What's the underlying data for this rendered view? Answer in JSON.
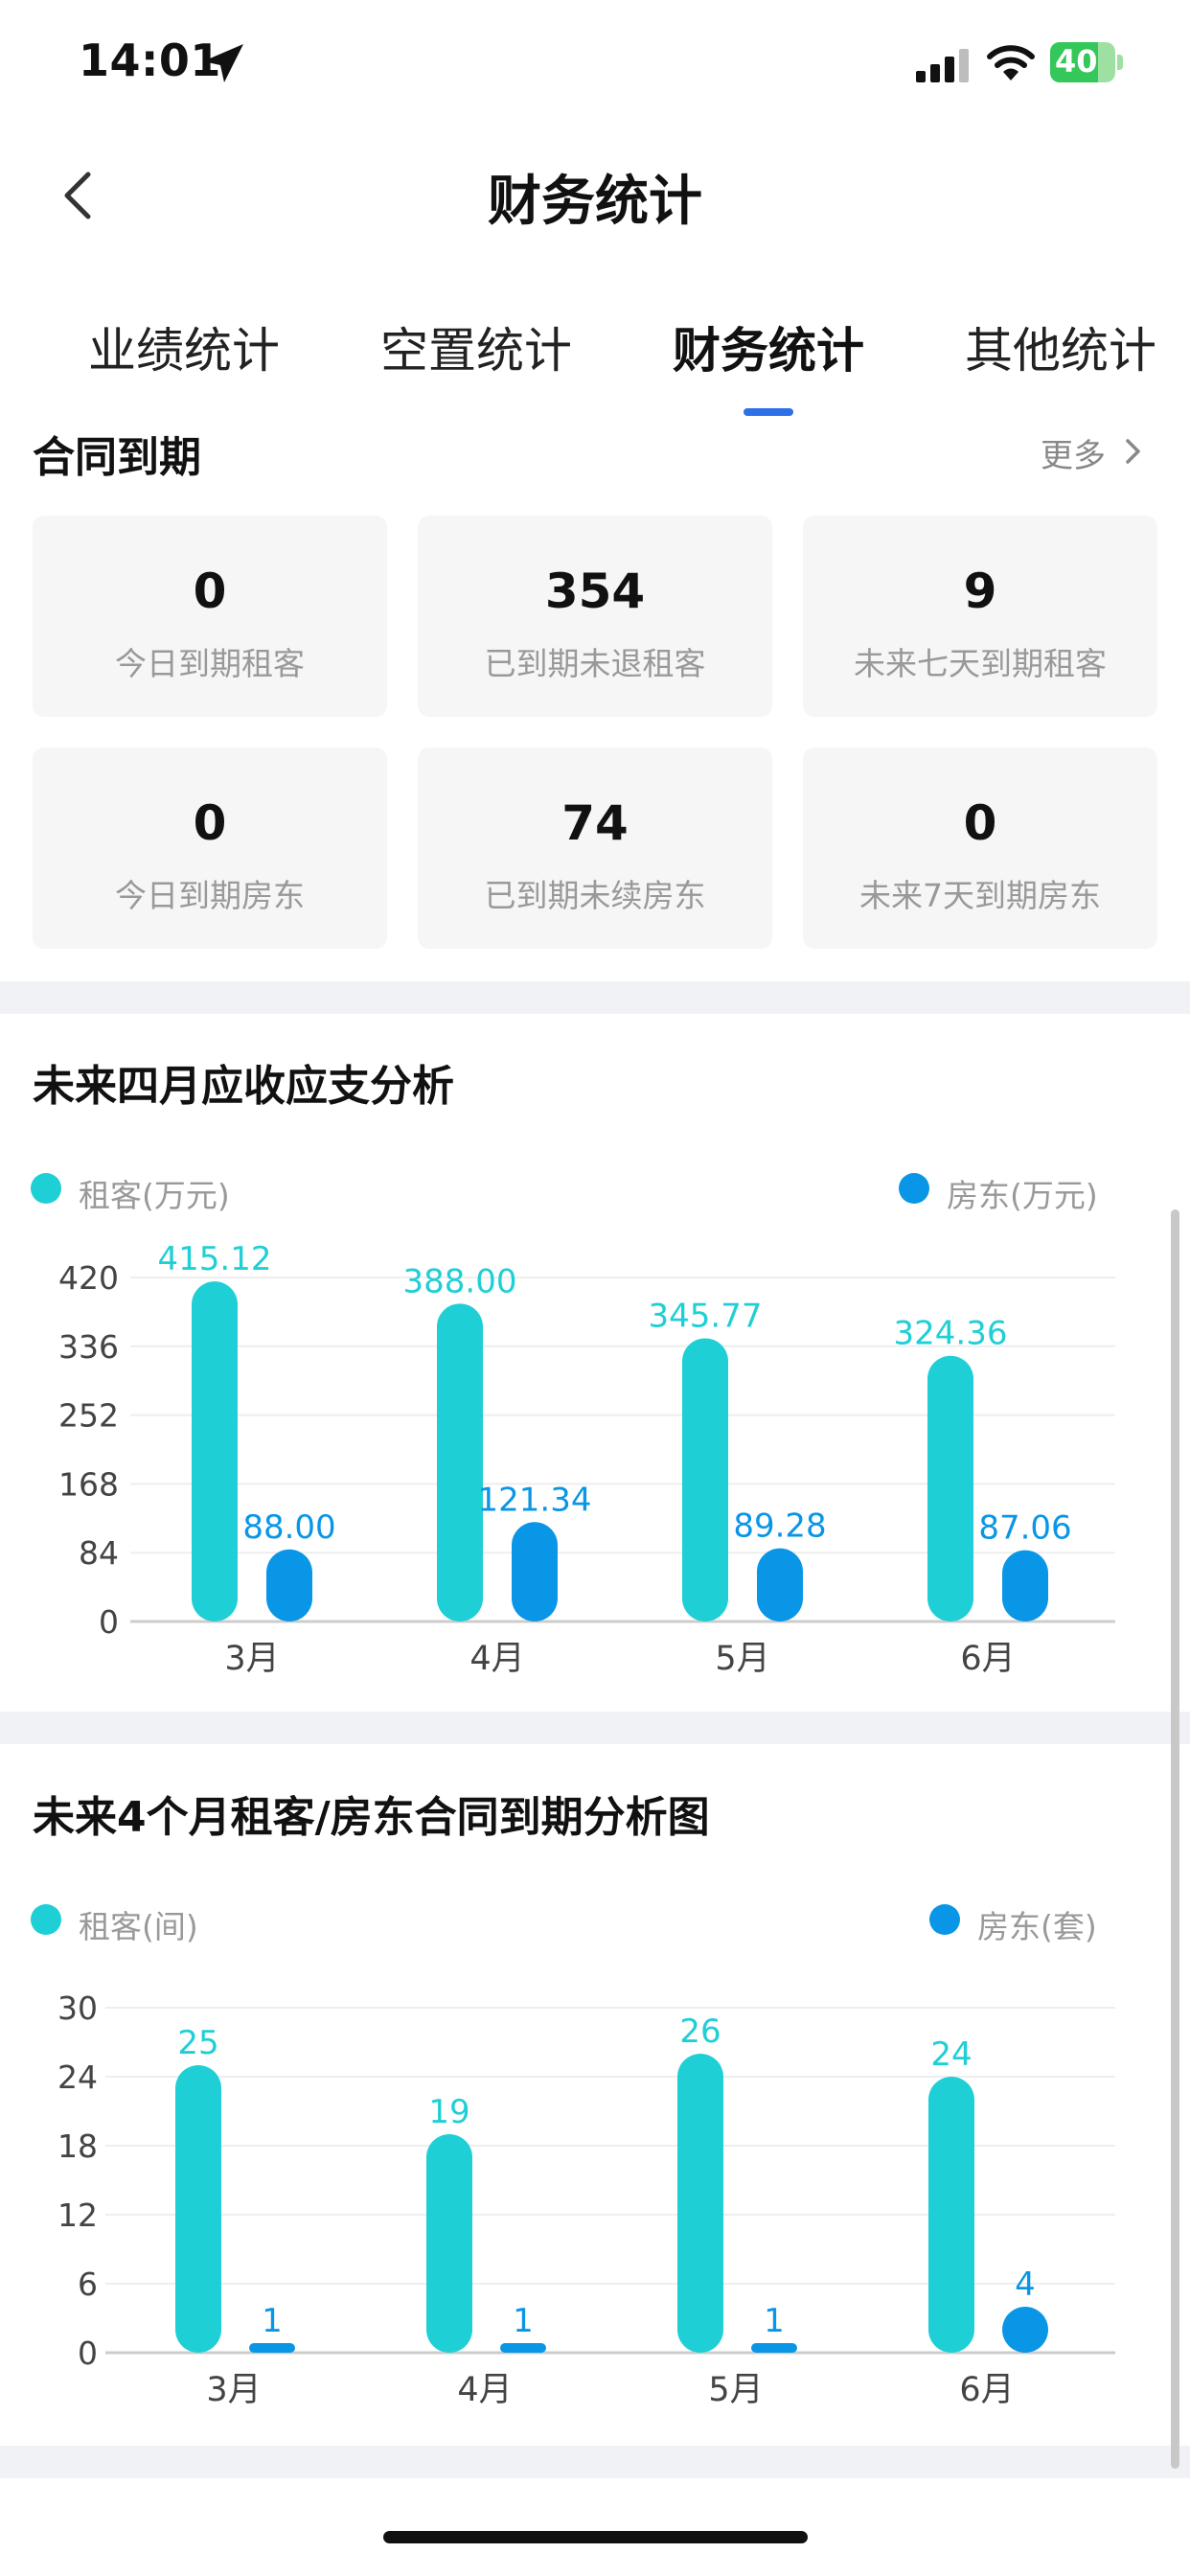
{
  "status_bar": {
    "time": "14:01",
    "battery": "40"
  },
  "header": {
    "title": "财务统计"
  },
  "tabs": [
    {
      "label": "业绩统计",
      "active": false
    },
    {
      "label": "空置统计",
      "active": false
    },
    {
      "label": "财务统计",
      "active": true
    },
    {
      "label": "其他统计",
      "active": false
    }
  ],
  "contract_expiry": {
    "title": "合同到期",
    "more_label": "更多",
    "cards": [
      {
        "value": "0",
        "label": "今日到期租客"
      },
      {
        "value": "354",
        "label": "已到期未退租客"
      },
      {
        "value": "9",
        "label": "未来七天到期租客"
      },
      {
        "value": "0",
        "label": "今日到期房东"
      },
      {
        "value": "74",
        "label": "已到期未续房东"
      },
      {
        "value": "0",
        "label": "未来7天到期房东"
      }
    ]
  },
  "colors": {
    "tenant": "#1fcfd6",
    "landlord": "#0a96e6",
    "accent": "#2f6fe8"
  },
  "finance_chart": {
    "title": "未来四月应收应支分析",
    "legend_tenant": "租客(万元)",
    "legend_landlord": "房东(万元)"
  },
  "expiry_chart": {
    "title": "未来4个月租客/房东合同到期分析图",
    "legend_tenant": "租客(间)",
    "legend_landlord": "房东(套)"
  },
  "chart_data": [
    {
      "type": "bar",
      "title": "未来四月应收应支分析",
      "categories": [
        "3月",
        "4月",
        "5月",
        "6月"
      ],
      "series": [
        {
          "name": "租客(万元)",
          "values": [
            415.12,
            388.0,
            345.77,
            324.36
          ],
          "labels": [
            "415.12",
            "388.00",
            "345.77",
            "324.36"
          ]
        },
        {
          "name": "房东(万元)",
          "values": [
            88.0,
            121.34,
            89.28,
            87.06
          ],
          "labels": [
            "88.00",
            "121.34",
            "89.28",
            "87.06"
          ]
        }
      ],
      "yticks": [
        "0",
        "84",
        "168",
        "252",
        "336",
        "420"
      ],
      "ylim": [
        0,
        420
      ],
      "grid": true,
      "legend": "top"
    },
    {
      "type": "bar",
      "title": "未来4个月租客/房东合同到期分析图",
      "categories": [
        "3月",
        "4月",
        "5月",
        "6月"
      ],
      "series": [
        {
          "name": "租客(间)",
          "values": [
            25,
            19,
            26,
            24
          ],
          "labels": [
            "25",
            "19",
            "26",
            "24"
          ]
        },
        {
          "name": "房东(套)",
          "values": [
            1,
            1,
            1,
            4
          ],
          "labels": [
            "1",
            "1",
            "1",
            "4"
          ]
        }
      ],
      "yticks": [
        "0",
        "6",
        "12",
        "18",
        "24",
        "30"
      ],
      "ylim": [
        0,
        30
      ],
      "grid": true,
      "legend": "top"
    }
  ]
}
